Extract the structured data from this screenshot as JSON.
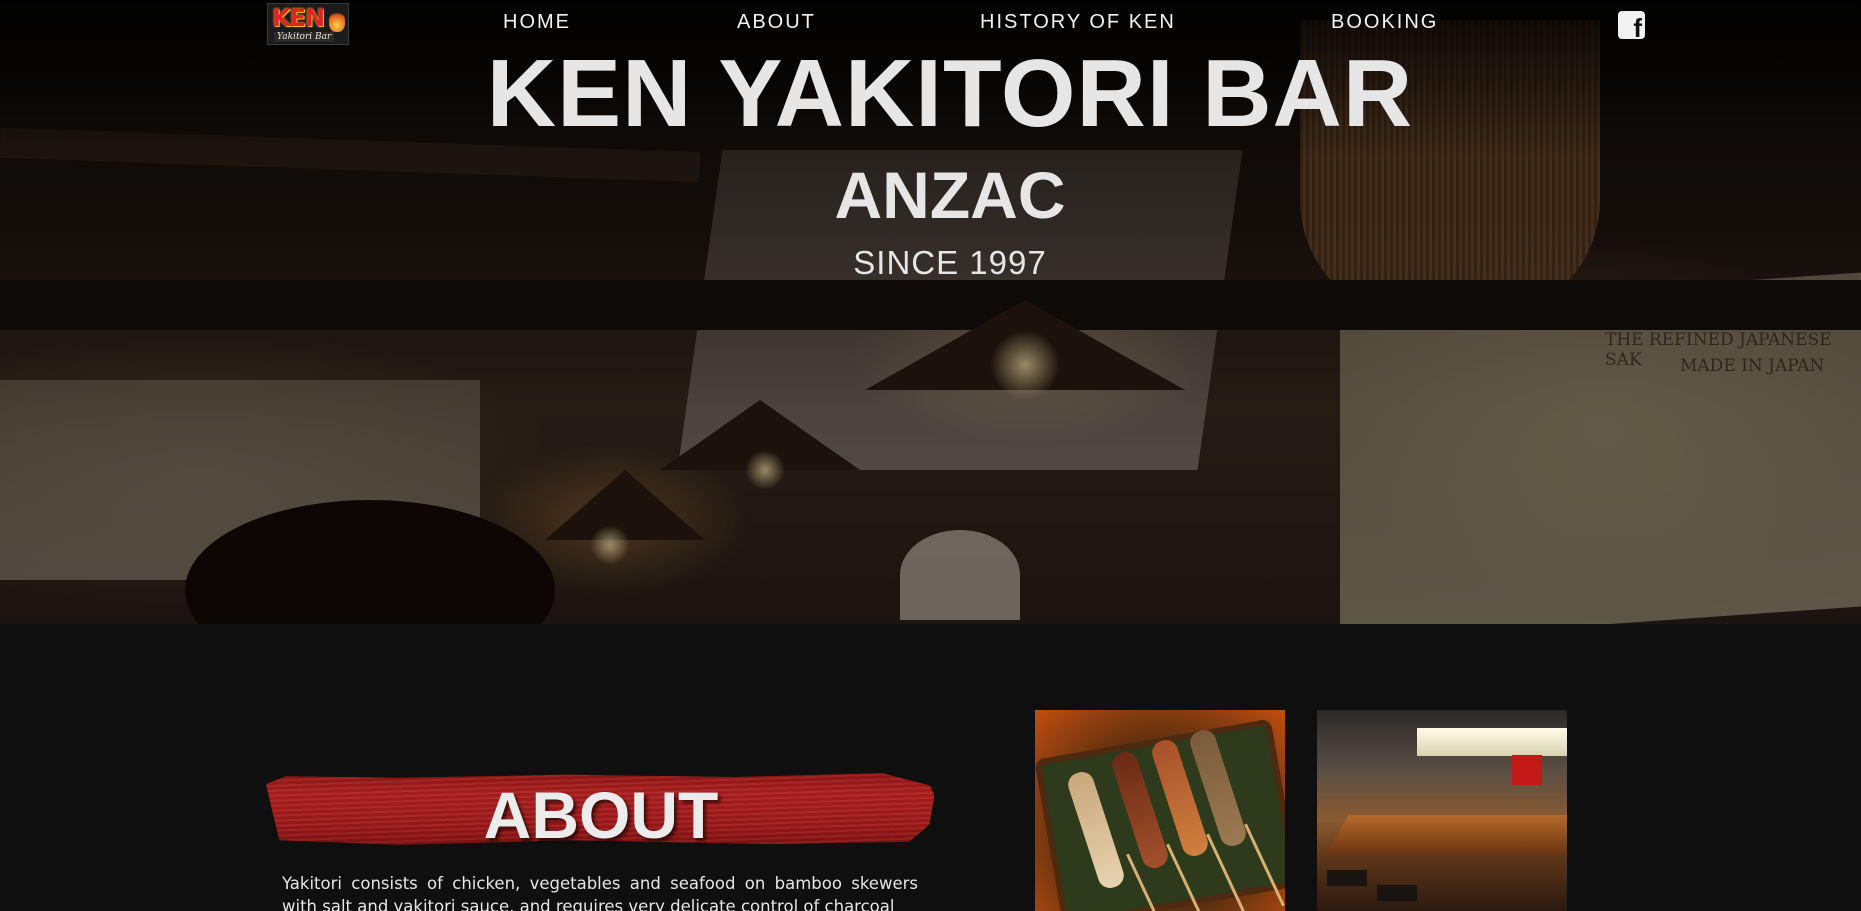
{
  "nav": {
    "logo_word": "KEN",
    "logo_sub": "Yakitori Bar",
    "links": [
      "HOME",
      "ABOUT",
      "HISTORY OF KEN",
      "BOOKING"
    ],
    "social_icon": "facebook-icon"
  },
  "hero": {
    "title": "KEN YAKITORI BAR",
    "subtitle": "ANZAC",
    "since": "SINCE 1997",
    "box_text_1": "THE REFINED JAPANESE SAK",
    "box_text_2": "MADE IN JAPAN"
  },
  "about": {
    "heading": "ABOUT",
    "text": "Yakitori consists of chicken, vegetables and seafood on bamboo skewers with salt and yakitori sauce, and requires very delicate control of charcoal"
  },
  "colors": {
    "background": "#0f0f0f",
    "brush_red": "#b02020",
    "text": "#e6e6e6"
  }
}
